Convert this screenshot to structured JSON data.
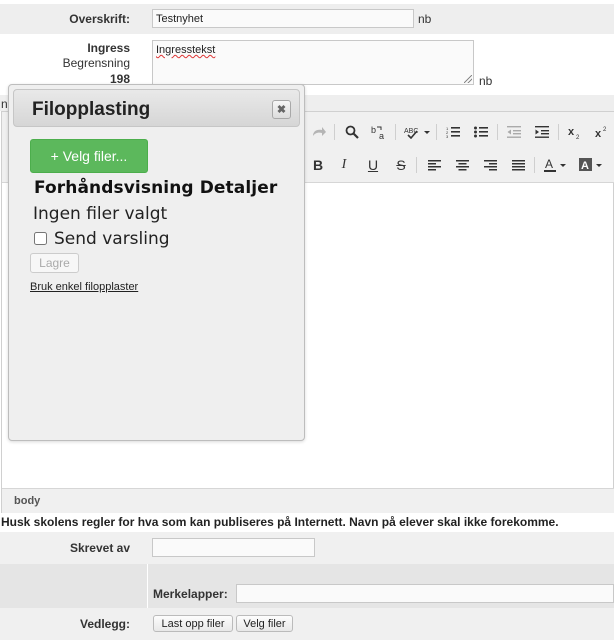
{
  "form": {
    "overskrift_label": "Overskrift:",
    "overskrift_value": "Testnyhet",
    "overskrift_lang": "nb",
    "ingress_label": "Ingress",
    "begrensning_label": "Begrensning",
    "begrensning_count": "198",
    "ingress_value": "Ingresstekst",
    "ingress_lang": "nb",
    "left_edge_letter": "n",
    "editor_status": "body",
    "rules_notice": "Husk skolens regler for hva som kan publiseres på Internett. Navn på elever skal ikke forekomme.",
    "skrevet_av_label": "Skrevet av",
    "skrevet_av_value": "",
    "merkelapper_label": "Merkelapper:",
    "merkelapper_value": "",
    "vedlegg_label": "Vedlegg:",
    "upload_button": "Last opp filer",
    "choose_button": "Velg filer"
  },
  "toolbar": {
    "icons": [
      "redo-icon",
      "find-icon",
      "replace-icon",
      "spellcheck-icon",
      "numbered-list-icon",
      "bullet-list-icon",
      "outdent-icon",
      "indent-icon",
      "subscript-icon",
      "superscript-icon",
      "bold-icon",
      "italic-icon",
      "underline-icon",
      "strikethrough-icon",
      "align-left-icon",
      "align-center-icon",
      "align-right-icon",
      "justify-icon",
      "text-color-icon",
      "background-color-icon"
    ]
  },
  "modal": {
    "title": "Filopplasting",
    "close_glyph": "✖",
    "choose_files_label": "+ Velg filer...",
    "preview_heading": "Forhåndsvisning Detaljer",
    "no_files": "Ingen filer valgt",
    "send_notice_label": "Send varsling",
    "save_label": "Lagre",
    "simple_uploader_link": "Bruk enkel filopplaster"
  },
  "colors": {
    "primary_green": "#5cb85c",
    "row_gray": "#eeeeee",
    "modal_bg": "#efefef"
  }
}
